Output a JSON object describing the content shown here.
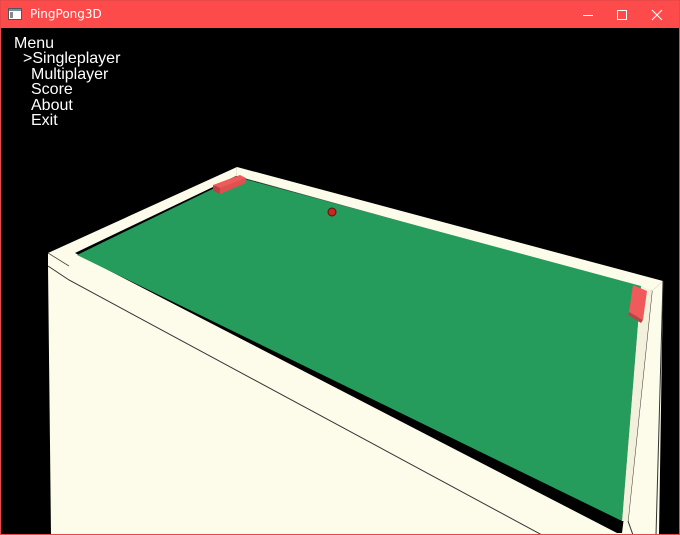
{
  "window": {
    "title": "PingPong3D",
    "titlebar_color": "#fd4b4b"
  },
  "controls": {
    "minimize_icon": "minimize-icon",
    "maximize_icon": "maximize-icon",
    "close_icon": "close-icon"
  },
  "menu": {
    "title": "Menu",
    "selected_marker": ">",
    "items": [
      {
        "label": "Singleplayer",
        "selected": true
      },
      {
        "label": "Multiplayer",
        "selected": false
      },
      {
        "label": "Score",
        "selected": false
      },
      {
        "label": "About",
        "selected": false
      },
      {
        "label": "Exit",
        "selected": false
      }
    ]
  },
  "scene": {
    "background_color": "#000000",
    "table_color": "#269c5c",
    "border_color": "#fdfcea",
    "border_shadow_color": "#d9d8c4",
    "paddle_color": "#f05a5a",
    "ball_color": "#c8281e"
  }
}
